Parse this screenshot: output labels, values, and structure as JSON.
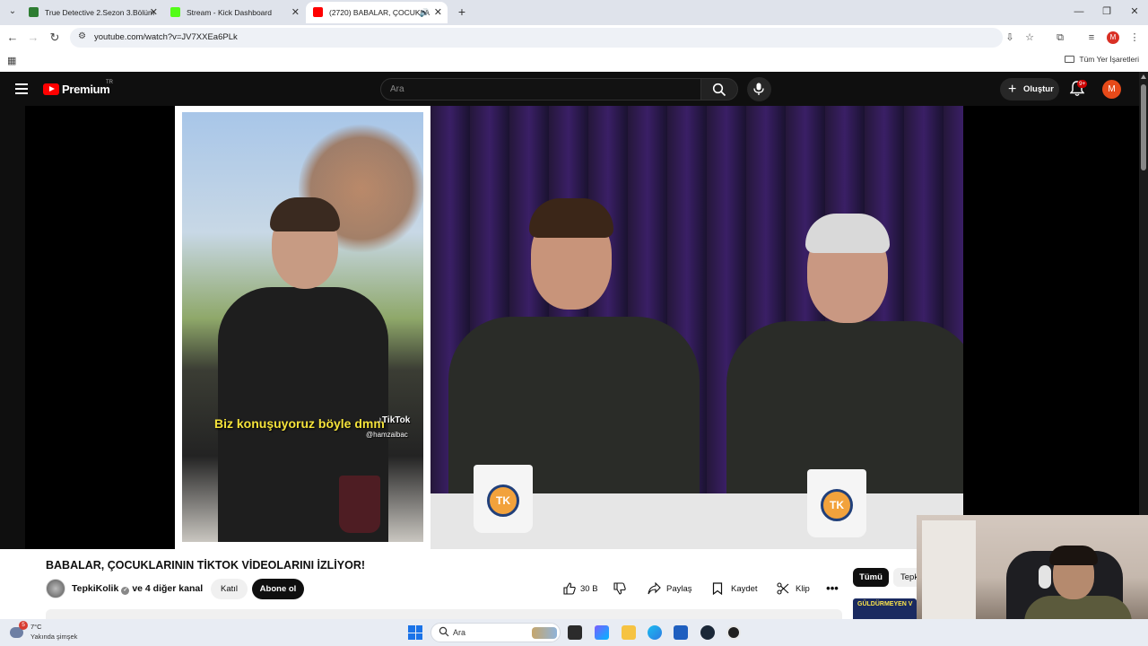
{
  "browser": {
    "tabs": [
      {
        "title": "True Detective 2.Sezon 3.Bölüm",
        "favicon_color": "#2e7d32",
        "active": false
      },
      {
        "title": "Stream - Kick Dashboard",
        "favicon_color": "#53fc18",
        "active": false
      },
      {
        "title": "(2720) BABALAR, ÇOCUKLA",
        "favicon_color": "#ff0000",
        "active": true
      }
    ],
    "url": "youtube.com/watch?v=JV7XXEa6PLk",
    "profile_initial": "M",
    "bookmarks_all_label": "Tüm Yer İşaretleri"
  },
  "youtube": {
    "logo_text": "Premium",
    "country_code": "TR",
    "search_placeholder": "Ara",
    "create_label": "Oluştur",
    "notification_badge": "9+",
    "avatar_initial": "M",
    "accent_color": "#ff0000"
  },
  "video": {
    "caption_text": "Biz konuşuyoruz böyle dmm",
    "tiktok_label": "TikTok",
    "tiktok_user": "@hamzaibac",
    "mug_logo": "TK",
    "title": "BABALAR, ÇOCUKLARININ TİKTOK VİDEOLARINI İZLİYOR!",
    "channel_name": "TepkiKolik",
    "channel_others": "ve 4 diğer kanal",
    "join_label": "Katıl",
    "subscribe_label": "Abone ol",
    "like_count": "30 B",
    "share_label": "Paylaş",
    "save_label": "Kaydet",
    "clip_label": "Klip",
    "more_label": "•••"
  },
  "related": {
    "chips": [
      "Tümü",
      "Tepki"
    ],
    "thumb_text": "GÜLDÜRMEYEN V"
  },
  "taskbar": {
    "weather_temp": "7°C",
    "weather_desc": "Yakında şimşek",
    "weather_badge": "5",
    "search_placeholder": "Ara"
  }
}
